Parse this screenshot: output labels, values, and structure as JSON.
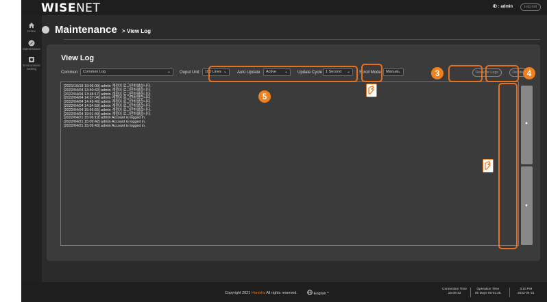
{
  "header": {
    "logo_main": "WISE",
    "logo_net": "NET",
    "user_id": "ID : admin",
    "logout_label": "Log out"
  },
  "sidebar": {
    "items": [
      {
        "label": "Home",
        "icon": "home-icon"
      },
      {
        "label": "Maintenance",
        "icon": "maintenance-icon"
      },
      {
        "label": "Environment Setting",
        "icon": "environment-setting-icon"
      }
    ]
  },
  "page": {
    "title": "Maintenance",
    "separator": ">",
    "subtitle": "View Log"
  },
  "panel": {
    "title": "View Log",
    "controls": {
      "common_label": "Common",
      "common_value": "Common Log",
      "output_unit_label": "Ouput Unit",
      "output_unit_value": "100 Lines",
      "auto_update_label": "Auto Update",
      "auto_update_value": "Active",
      "update_cycle_label": "Update Cycle",
      "update_cycle_value": "1 Second",
      "scroll_mode_label": "Scroll Mode",
      "scroll_mode_value": "Manual",
      "receive_logs_label": "Receive Logs",
      "delete_logs_label": "Delete Logs"
    },
    "logs": [
      "[2021/10/18 19:06:09] admin 계정이 로그인하였습니다.",
      "[2022/04/04 13:40:42] admin 계정이 로그인하였습니다.",
      "[2022/04/04 13:48:17] admin 계정이 로그인하였습니다.",
      "[2022/04/04 14:37:04] admin 계정이 로그인하였습니다.",
      "[2022/04/04 14:49:49] admin 계정이 로그인하였습니다.",
      "[2022/04/04 14:54:59] admin 계정이 로그인하였습니다.",
      "[2022/04/04 15:56:55] admin 계정이 로그인하였습니다.",
      "[2022/04/04 19:01:49] admin 계정이 로그인하였습니다.",
      "[2022/04/21 15:06:19] admin Account is logged in.",
      "[2022/04/21 15:09:42] admin Account is logged in.",
      "[2022/04/21 15:09:43] admin Account is logged in."
    ],
    "scroll_up": "▲",
    "scroll_down": "▼"
  },
  "annotations": {
    "badge_3": "3",
    "badge_4": "4",
    "badge_5": "5",
    "color": "#e8711f"
  },
  "footer": {
    "copyright_prefix": "Copyright 2021",
    "copyright_brand": "Hanwha",
    "copyright_suffix": "All rights reserved.",
    "language": "English ^",
    "connection_time_label": "Connection Time",
    "connection_time_value": "15:09:43",
    "operation_time_label": "Operation Time",
    "operation_time_value": "00 Days 00:01:25",
    "clock_time": "3:10 PM",
    "clock_date": "2022-04-21"
  }
}
